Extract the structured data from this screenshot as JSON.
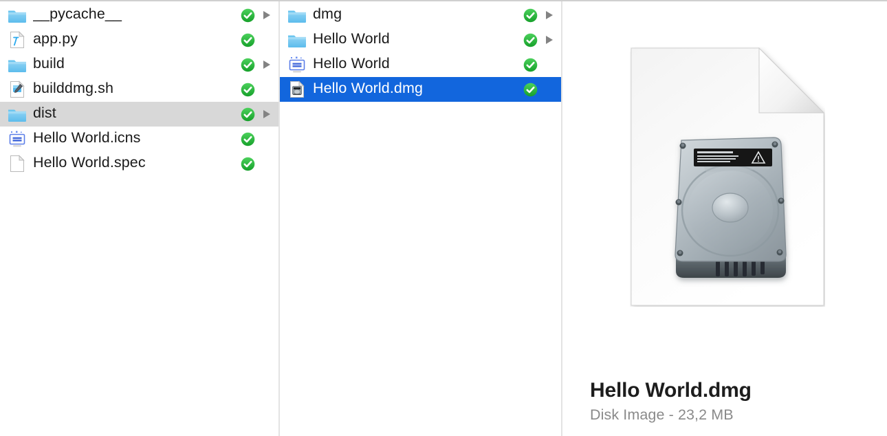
{
  "window": {
    "view_mode": "column",
    "accent_color": "#1266dd",
    "inactive_selection_color": "#d8d8d8",
    "badge_color": "#29b539"
  },
  "columns": [
    {
      "name": "column-1",
      "items": [
        {
          "label": "__pycache__",
          "icon": "folder-icon",
          "badge": "green-check-badge",
          "has_chevron": true,
          "selected": false
        },
        {
          "label": "app.py",
          "icon": "python-file-icon",
          "badge": "green-check-badge",
          "has_chevron": false,
          "selected": false
        },
        {
          "label": "build",
          "icon": "folder-icon",
          "badge": "green-check-badge",
          "has_chevron": true,
          "selected": false
        },
        {
          "label": "builddmg.sh",
          "icon": "shell-script-icon",
          "badge": "green-check-badge",
          "has_chevron": false,
          "selected": false
        },
        {
          "label": "dist",
          "icon": "folder-icon",
          "badge": "green-check-badge",
          "has_chevron": true,
          "selected": "inactive"
        },
        {
          "label": "Hello World.icns",
          "icon": "icns-file-icon",
          "badge": "green-check-badge",
          "has_chevron": false,
          "selected": false
        },
        {
          "label": "Hello World.spec",
          "icon": "plain-document-icon",
          "badge": "green-check-badge",
          "has_chevron": false,
          "selected": false
        }
      ]
    },
    {
      "name": "column-2",
      "items": [
        {
          "label": "dmg",
          "icon": "folder-icon",
          "badge": "green-check-badge",
          "has_chevron": true,
          "selected": false
        },
        {
          "label": "Hello World",
          "icon": "folder-icon",
          "badge": "green-check-badge",
          "has_chevron": true,
          "selected": false
        },
        {
          "label": "Hello World",
          "icon": "icns-file-icon",
          "badge": "green-check-badge",
          "has_chevron": false,
          "selected": false
        },
        {
          "label": "Hello World.dmg",
          "icon": "dmg-file-icon",
          "badge": "green-check-badge",
          "has_chevron": false,
          "selected": "active"
        }
      ]
    }
  ],
  "preview": {
    "icon": "dmg-document-large-icon",
    "title": "Hello World.dmg",
    "subtitle": "Disk Image - 23,2 MB",
    "kind": "Disk Image",
    "size": "23,2 MB"
  }
}
